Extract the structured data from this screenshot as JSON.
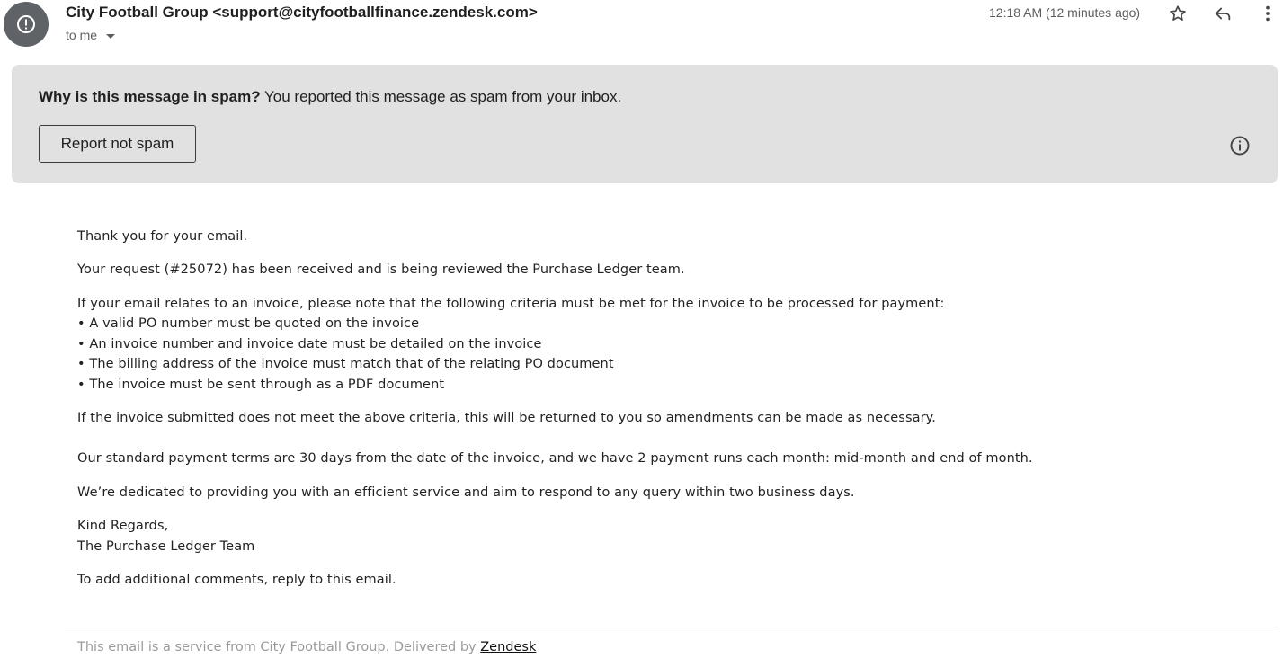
{
  "header": {
    "sender": "City Football Group <support@cityfootballfinance.zendesk.com>",
    "recipient": "to me",
    "timestamp": "12:18 AM (12 minutes ago)",
    "avatar_icon": "spam-warning-icon"
  },
  "spam_banner": {
    "question": "Why is this message in spam?",
    "reason": "You reported this message as spam from your inbox.",
    "button_label": "Report not spam"
  },
  "body": {
    "greeting": "Thank you for your email.",
    "request": "Your request (#25072) has been received and is being reviewed the Purchase Ledger team.",
    "criteria_intro": "If your email relates to an invoice, please note that the following criteria must be met for the invoice to be processed for payment:",
    "criteria": [
      "• A valid PO number must be quoted on the invoice",
      "• An invoice number and invoice date must be detailed on the invoice",
      "• The billing address of the invoice must match that of the relating PO document",
      "• The invoice must be sent through as a PDF document"
    ],
    "returned_note": "If the invoice submitted does not meet the above criteria, this will be returned to you so amendments can be made as necessary.",
    "payment_terms": "Our standard payment terms are 30 days from the date of the invoice, and we have 2 payment runs each month: mid-month and end of month.",
    "service_note": "We’re dedicated to providing you with an efficient service and aim to respond to any query within two business days.",
    "signoff": "Kind Regards,",
    "signature": "The Purchase Ledger Team",
    "reply_note": "To add additional comments, reply to this email."
  },
  "footer": {
    "prefix": "This email is a service from City Football Group. Delivered by ",
    "link_text": "Zendesk"
  }
}
